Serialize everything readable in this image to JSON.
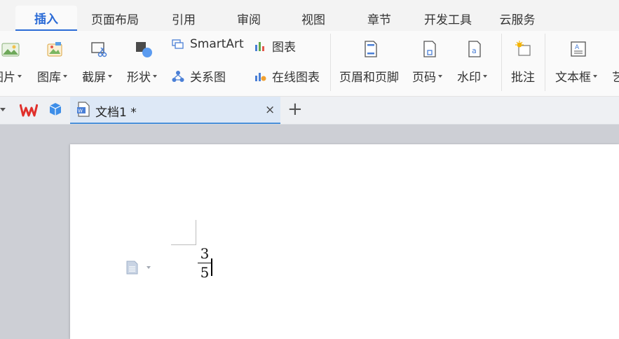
{
  "ribbon_tabs": {
    "insert": "插入",
    "page_layout": "页面布局",
    "references": "引用",
    "review": "审阅",
    "view": "视图",
    "sections": "章节",
    "dev_tools": "开发工具",
    "cloud": "云服务"
  },
  "ribbon": {
    "picture": "图片",
    "gallery": "图库",
    "screenshot": "截屏",
    "shapes": "形状",
    "smartart": "SmartArt",
    "relation_chart": "关系图",
    "chart": "图表",
    "online_chart": "在线图表",
    "header_footer": "页眉和页脚",
    "page_number": "页码",
    "watermark": "水印",
    "comment": "批注",
    "text_box": "文本框",
    "art_text_partial": "艺"
  },
  "document_tab": {
    "title": "文档1 *",
    "close_glyph": "×",
    "new_tab_glyph": "+"
  },
  "document": {
    "numerator": "3",
    "denominator": "5"
  },
  "colors": {
    "accent": "#2b6bd6",
    "wps_red": "#e0302b"
  }
}
